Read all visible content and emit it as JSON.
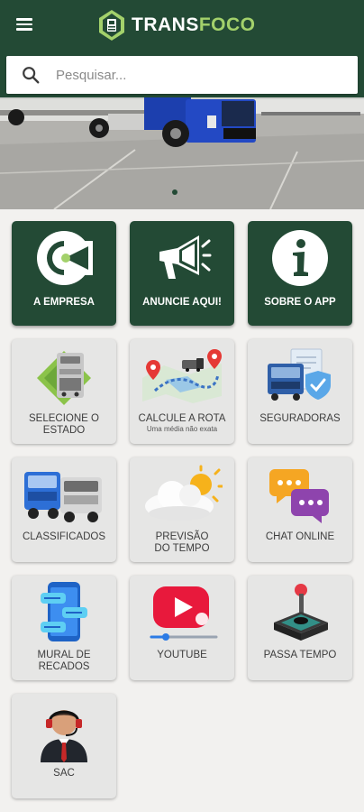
{
  "app": {
    "logo_text_a": "TRANS",
    "logo_text_b": "FOCO"
  },
  "search": {
    "placeholder": "Pesquisar..."
  },
  "colors": {
    "brand_dark": "#234a35",
    "brand_accent": "#a3d16b",
    "tile_light": "#e6e6e5"
  },
  "tiles": [
    {
      "label": "A EMPRESA",
      "icon": "company-icon"
    },
    {
      "label": "ANUNCIE AQUI!",
      "icon": "megaphone-icon"
    },
    {
      "label": "SOBRE O APP",
      "icon": "info-icon"
    },
    {
      "label": "SELECIONE O ESTADO",
      "icon": "state-map-icon"
    },
    {
      "label": "CALCULE A ROTA",
      "sublabel": "Uma média não exata",
      "icon": "route-map-icon"
    },
    {
      "label": "SEGURADORAS",
      "icon": "insurance-icon"
    },
    {
      "label": "CLASSIFICADOS",
      "icon": "trucks-icon"
    },
    {
      "label": "PREVISÃO DO TEMPO",
      "icon": "weather-icon"
    },
    {
      "label": "CHAT ONLINE",
      "icon": "chat-icon"
    },
    {
      "label": "MURAL DE RECADOS",
      "icon": "message-board-icon"
    },
    {
      "label": "YOUTUBE",
      "icon": "youtube-icon"
    },
    {
      "label": "PASSA TEMPO",
      "icon": "joystick-icon"
    },
    {
      "label": "SAC",
      "icon": "support-agent-icon"
    }
  ]
}
